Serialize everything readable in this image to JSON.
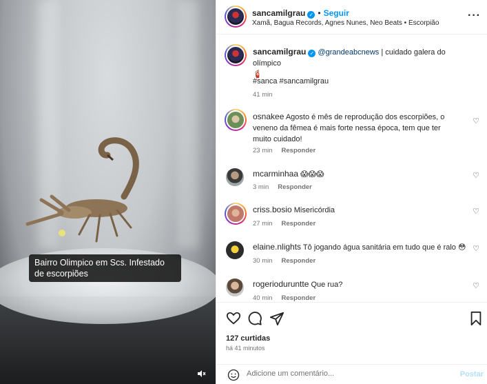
{
  "media": {
    "caption": "Bairro Olimpico em Scs. Infestado de escorpiões",
    "mute_icon": "speaker-muted-icon"
  },
  "header": {
    "username": "sancamilgrau",
    "follow_label": "Seguir",
    "subline": "Xamã, Bagua Records, Agnes Nunes, Neo Beats • Escorpião"
  },
  "post_caption": {
    "username": "sancamilgrau",
    "mention": "@grandeabcnews",
    "text": " | cuidado galera do olímpico",
    "emoji": "🧯",
    "hashtags": "#sanca #sancamilgrau",
    "time": "41 min"
  },
  "comments": [
    {
      "username": "osnakee",
      "text": "Agosto é mês de reprodução dos escorpiões, o veneno da fêmea é mais forte nessa época, tem que ter muito cuidado!",
      "time": "23 min",
      "reply": "Responder"
    },
    {
      "username": "mcarminhaa",
      "text": "😱😱😱",
      "time": "3 min",
      "reply": "Responder"
    },
    {
      "username": "criss.bosio",
      "text": "Misericórdia",
      "time": "27 min",
      "reply": "Responder"
    },
    {
      "username": "elaine.nlights",
      "text": "Tô jogando água sanitária em tudo que é ralo 😳",
      "time": "30 min",
      "reply": "Responder"
    },
    {
      "username": "rogerioduruntte",
      "text": "Que rua?",
      "time": "40 min",
      "reply": "Responder"
    }
  ],
  "actions": {
    "likes": "127 curtidas",
    "posted": "há 41 minutos"
  },
  "add_comment": {
    "placeholder": "Adicione um comentário...",
    "post_label": "Postar"
  },
  "colors": {
    "accent": "#0095f6",
    "muted_text": "#737373",
    "hashtag": "#4d5fbf"
  }
}
